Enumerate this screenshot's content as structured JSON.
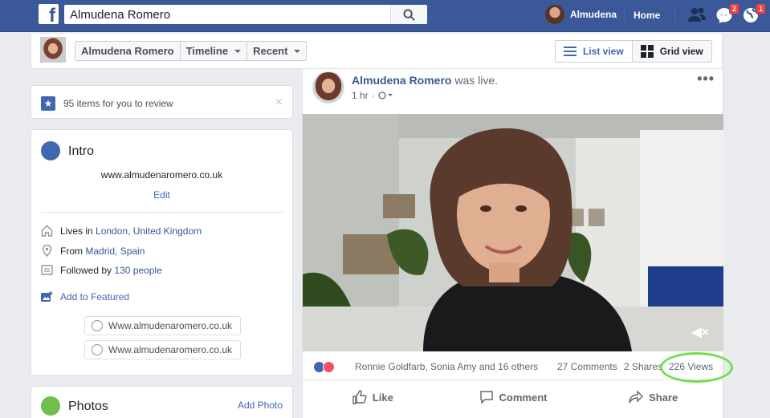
{
  "topbar": {
    "logo": "f",
    "search_value": "Almudena Romero",
    "user_name": "Almudena",
    "home_label": "Home",
    "messages_badge": "2",
    "notifications_badge": "1"
  },
  "subheader": {
    "name": "Almudena Romero",
    "timeline_label": "Timeline",
    "recent_label": "Recent",
    "list_view_label": "List view",
    "grid_view_label": "Grid view"
  },
  "review": {
    "text": "95 items for you to review",
    "close": "×"
  },
  "intro": {
    "title": "Intro",
    "website": "www.almudenaromero.co.uk",
    "edit_label": "Edit",
    "lives_prefix": "Lives in",
    "lives_link": "London, United Kingdom",
    "from_prefix": "From",
    "from_link": "Madrid, Spain",
    "followed_prefix": "Followed by",
    "followed_link": "130 people",
    "add_featured": "Add to Featured",
    "links": [
      "Www.almudenaromero.co.uk",
      "Www.almudenaromero.co.uk"
    ]
  },
  "photos": {
    "title": "Photos",
    "add_label": "Add Photo"
  },
  "post": {
    "author": "Almudena Romero",
    "action": "was live.",
    "time": "1 hr",
    "more": "•••",
    "reaction_names": "Ronnie Goldfarb, Sonia Amy and 16 others",
    "comments": "27 Comments",
    "shares": "2 Shares",
    "views": "226 Views",
    "like_label": "Like",
    "comment_label": "Comment",
    "share_label": "Share",
    "mute_glyph": "◀×"
  },
  "colors": {
    "brand": "#3b5998",
    "link": "#385898",
    "highlight": "#6fe04b"
  }
}
